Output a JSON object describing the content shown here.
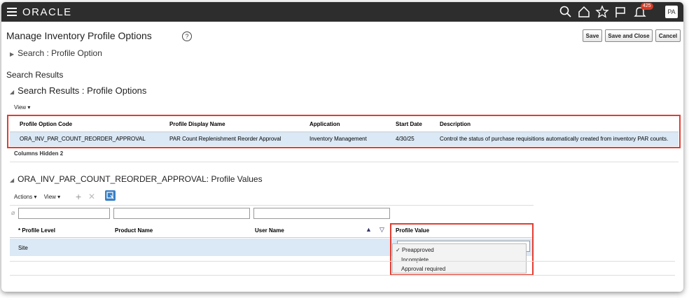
{
  "header": {
    "brand": "ORACLE",
    "notification_count": "425",
    "avatar_initials": "PA"
  },
  "page": {
    "title": "Manage Inventory Profile Options",
    "help": "?",
    "buttons": {
      "save": "Save",
      "save_close": "Save and Close",
      "cancel": "Cancel"
    }
  },
  "search": {
    "label": "Search : Profile Option"
  },
  "results": {
    "section_title": "Search Results",
    "subsection_title": "Search Results : Profile Options",
    "view_menu": "View ▾",
    "columns": [
      "Profile Option Code",
      "Profile Display Name",
      "Application",
      "Start Date",
      "Description"
    ],
    "row": {
      "code": "ORA_INV_PAR_COUNT_REORDER_APPROVAL",
      "display_name": "PAR Count Replenishment Reorder Approval",
      "application": "Inventory Management",
      "start_date": "4/30/25",
      "description": "Control the status of purchase requisitions automatically created from inventory PAR counts."
    },
    "columns_hidden": "Columns Hidden  2"
  },
  "values": {
    "title": "ORA_INV_PAR_COUNT_REORDER_APPROVAL: Profile Values",
    "actions_menu": "Actions ▾",
    "view_menu": "View ▾",
    "columns": {
      "required_mark": "*",
      "profile_level": "Profile Level",
      "product_name": "Product Name",
      "user_name": "User Name",
      "profile_value": "Profile Value"
    },
    "row": {
      "profile_level": "Site"
    },
    "dropdown_options": [
      "Preapproved",
      "Incomplete",
      "Approval required"
    ],
    "selected_check": "✓"
  },
  "colors": {
    "topbar": "#2d2d2d",
    "selected_row": "#dbe8f5",
    "highlight_box": "#e23d30",
    "badge": "#d63b25"
  }
}
